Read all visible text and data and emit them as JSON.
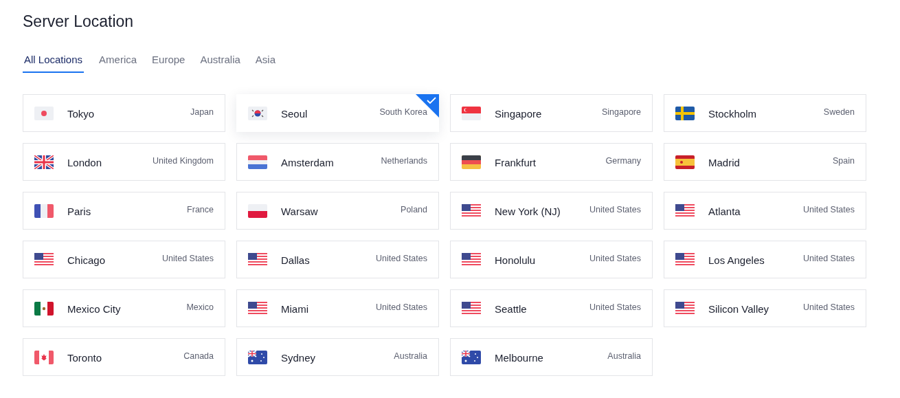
{
  "title": "Server Location",
  "tabs": [
    {
      "label": "All Locations",
      "selected": true
    },
    {
      "label": "America",
      "selected": false
    },
    {
      "label": "Europe",
      "selected": false
    },
    {
      "label": "Australia",
      "selected": false
    },
    {
      "label": "Asia",
      "selected": false
    }
  ],
  "locations": [
    {
      "city": "Tokyo",
      "country": "Japan",
      "kind": "jp",
      "selected": false
    },
    {
      "city": "Seoul",
      "country": "South Korea",
      "kind": "kr",
      "selected": true
    },
    {
      "city": "Singapore",
      "country": "Singapore",
      "kind": "sg",
      "selected": false
    },
    {
      "city": "Stockholm",
      "country": "Sweden",
      "kind": "se",
      "selected": false
    },
    {
      "city": "London",
      "country": "United Kingdom",
      "kind": "gb",
      "selected": false
    },
    {
      "city": "Amsterdam",
      "country": "Netherlands",
      "kind": "nl",
      "selected": false
    },
    {
      "city": "Frankfurt",
      "country": "Germany",
      "kind": "de",
      "selected": false
    },
    {
      "city": "Madrid",
      "country": "Spain",
      "kind": "es",
      "selected": false
    },
    {
      "city": "Paris",
      "country": "France",
      "kind": "fr",
      "selected": false
    },
    {
      "city": "Warsaw",
      "country": "Poland",
      "kind": "pl",
      "selected": false
    },
    {
      "city": "New York (NJ)",
      "country": "United States",
      "kind": "us",
      "selected": false
    },
    {
      "city": "Atlanta",
      "country": "United States",
      "kind": "us",
      "selected": false
    },
    {
      "city": "Chicago",
      "country": "United States",
      "kind": "us",
      "selected": false
    },
    {
      "city": "Dallas",
      "country": "United States",
      "kind": "us",
      "selected": false
    },
    {
      "city": "Honolulu",
      "country": "United States",
      "kind": "us",
      "selected": false
    },
    {
      "city": "Los Angeles",
      "country": "United States",
      "kind": "us",
      "selected": false
    },
    {
      "city": "Mexico City",
      "country": "Mexico",
      "kind": "mx",
      "selected": false
    },
    {
      "city": "Miami",
      "country": "United States",
      "kind": "us",
      "selected": false
    },
    {
      "city": "Seattle",
      "country": "United States",
      "kind": "us",
      "selected": false
    },
    {
      "city": "Silicon Valley",
      "country": "United States",
      "kind": "us",
      "selected": false
    },
    {
      "city": "Toronto",
      "country": "Canada",
      "kind": "ca",
      "selected": false
    },
    {
      "city": "Sydney",
      "country": "Australia",
      "kind": "au",
      "selected": false
    },
    {
      "city": "Melbourne",
      "country": "Australia",
      "kind": "au",
      "selected": false
    }
  ]
}
